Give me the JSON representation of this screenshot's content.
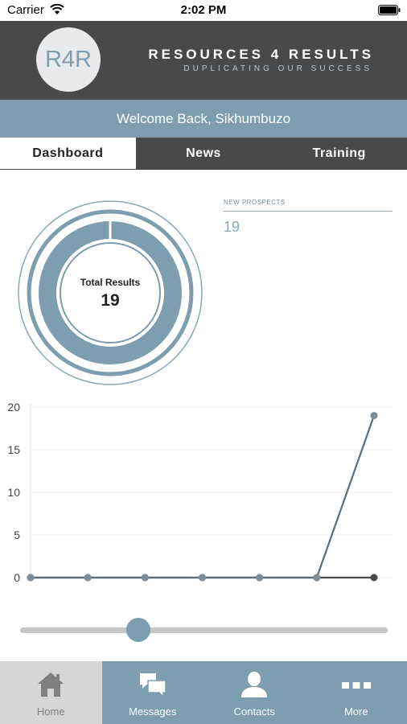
{
  "status_bar": {
    "carrier": "Carrier",
    "time": "2:02 PM"
  },
  "header": {
    "logo_text": "R4R",
    "title": "RESOURCES 4 RESULTS",
    "subtitle": "DUPLICATING OUR SUCCESS"
  },
  "welcome": {
    "text": "Welcome Back, Sikhumbuzo"
  },
  "tabs": [
    {
      "label": "Dashboard",
      "active": true
    },
    {
      "label": "News",
      "active": false
    },
    {
      "label": "Training",
      "active": false
    }
  ],
  "summary": {
    "total_label": "Total Results",
    "total_value": "19"
  },
  "new_prospects": {
    "title": "NEW PROSPECTS",
    "value": "19"
  },
  "chart_data": {
    "type": "line",
    "x": [
      1,
      2,
      3,
      4,
      5,
      6,
      7
    ],
    "series": [
      {
        "values": [
          0,
          0,
          0,
          0,
          0,
          0,
          0
        ],
        "color": "#4a4b4d"
      },
      {
        "values": [
          0,
          0,
          0,
          0,
          0,
          0,
          19
        ],
        "color": "#5a6c7a"
      }
    ],
    "ylim": [
      0,
      20
    ],
    "yticks": [
      "20",
      "15",
      "10",
      "5",
      "0"
    ],
    "grid": true
  },
  "slider": {
    "value_fraction": 0.31
  },
  "colors": {
    "accent": "#7d9eae",
    "dark": "#48494b"
  },
  "bottom_nav": [
    {
      "label": "Home",
      "icon": "home-icon",
      "active": true
    },
    {
      "label": "Messages",
      "icon": "messages-icon",
      "active": false
    },
    {
      "label": "Contacts",
      "icon": "contacts-icon",
      "active": false
    },
    {
      "label": "More",
      "icon": "more-icon",
      "active": false
    }
  ]
}
